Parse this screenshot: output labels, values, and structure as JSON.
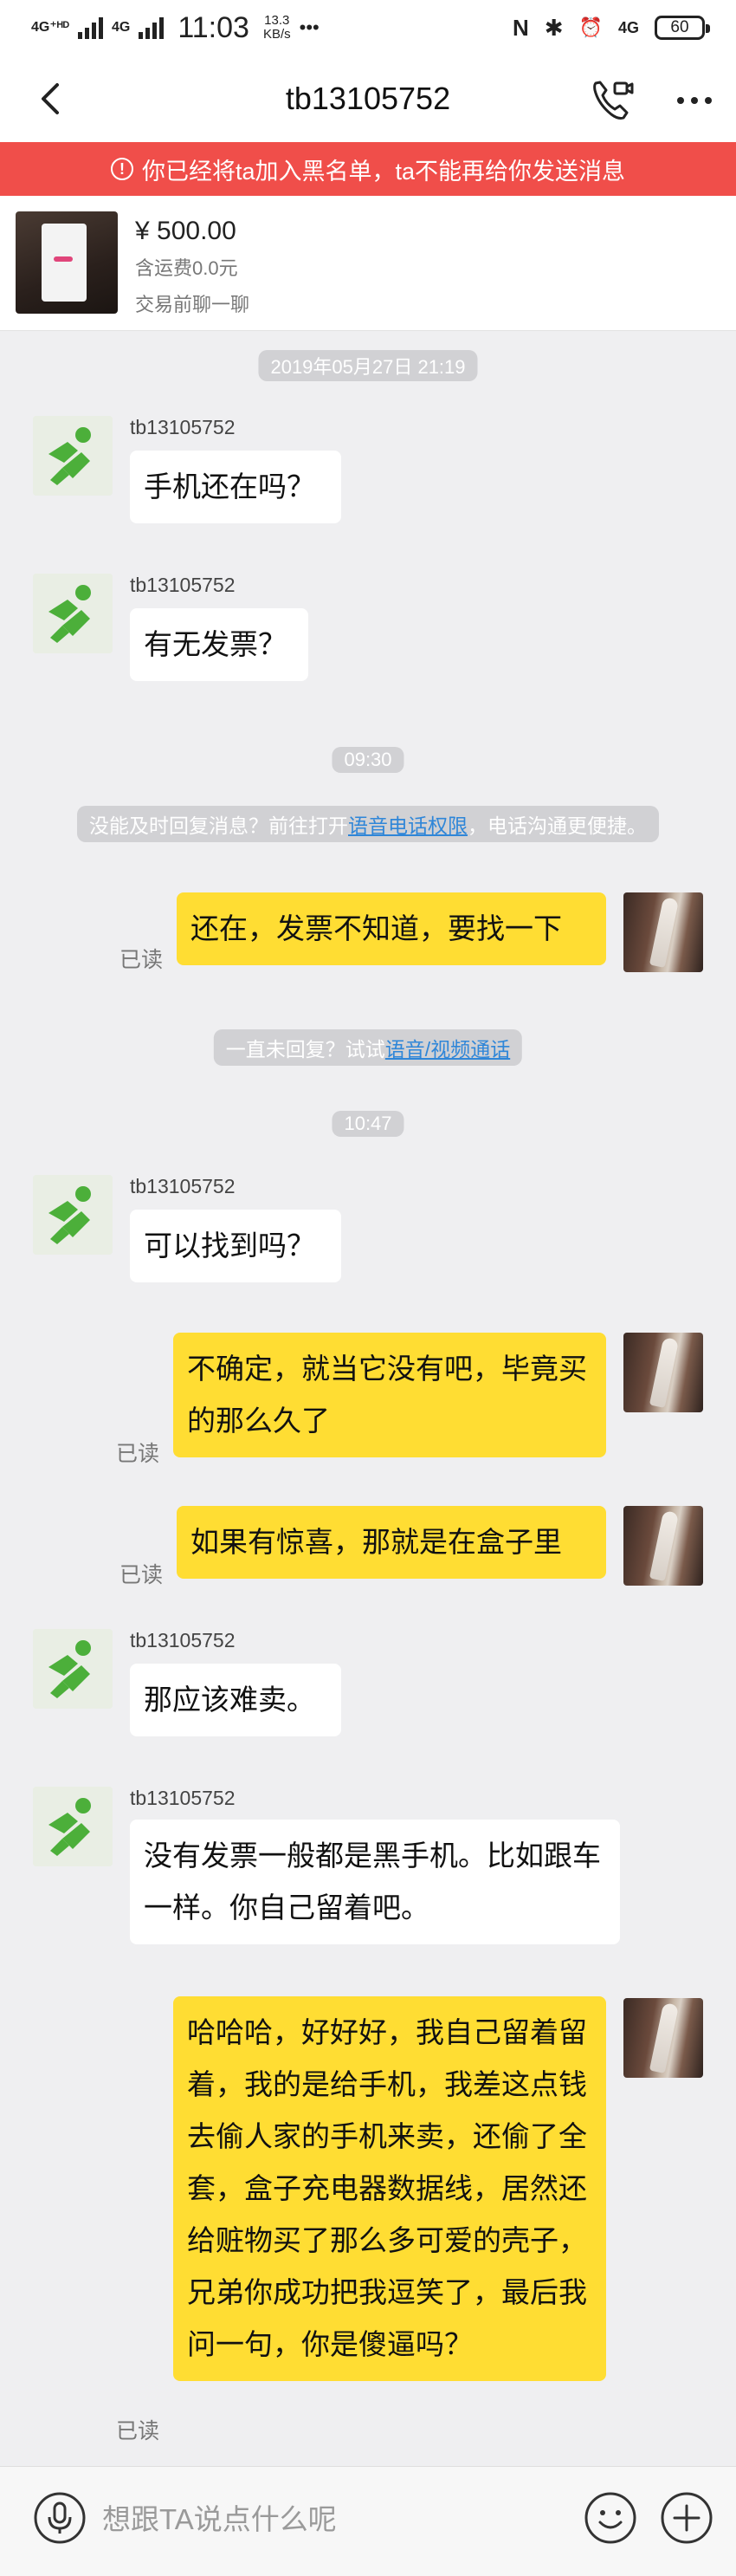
{
  "status_bar": {
    "network_1": "4G⁺ᴴᴰ",
    "network_2": "4G",
    "time": "11:03",
    "speed_value": "13.3",
    "speed_unit": "KB/s",
    "dots": "•••",
    "nfc": "N",
    "bluetooth": "✱",
    "alarm": "⏰",
    "network_right": "4G",
    "battery": "60"
  },
  "header": {
    "title": "tb13105752"
  },
  "banner": {
    "icon": "!",
    "text": "你已经将ta加入黑名单，ta不能再给你发送消息"
  },
  "product": {
    "price": "¥ 500.00",
    "shipping": "含运费0.0元",
    "hint": "交易前聊一聊"
  },
  "chat": {
    "timestamps": [
      "2019年05月27日 21:19",
      "09:30",
      "10:47"
    ],
    "notice_1": {
      "prefix": "没能及时回复消息？前往打开",
      "link": "语音电话权限",
      "suffix": "，电话沟通更便捷。"
    },
    "notice_2": {
      "prefix": "一直未回复？试试",
      "link": "语音/视频通话"
    },
    "messages": [
      {
        "sender": "tb13105752",
        "text": "手机还在吗？"
      },
      {
        "sender": "tb13105752",
        "text": "有无发票？"
      },
      {
        "text": "还在，发票不知道，要找一下",
        "status": "已读"
      },
      {
        "sender": "tb13105752",
        "text": "可以找到吗？"
      },
      {
        "text": "不确定，就当它没有吧，毕竟买的那么久了",
        "status": "已读"
      },
      {
        "text": "如果有惊喜，那就是在盒子里",
        "status": "已读"
      },
      {
        "sender": "tb13105752",
        "text": "那应该难卖。"
      },
      {
        "sender": "tb13105752",
        "text": "没有发票一般都是黑手机。比如跟车一样。你自己留着吧。"
      },
      {
        "text": "哈哈哈，好好好，我自己留着留着，我的是给手机，我差这点钱去偷人家的手机来卖，还偷了全套，盒子充电器数据线，居然还给赃物买了那么多可爱的壳子，兄弟你成功把我逗笑了，最后我问一句，你是傻逼吗？",
        "status": "已读"
      }
    ]
  },
  "input": {
    "placeholder": "想跟TA说点什么呢"
  },
  "colors": {
    "banner": "#f04e4a",
    "outgoing_bubble": "#ffdd33",
    "incoming_bubble": "#ffffff",
    "link": "#2f86d8",
    "avatar_green": "#4caf3a"
  }
}
